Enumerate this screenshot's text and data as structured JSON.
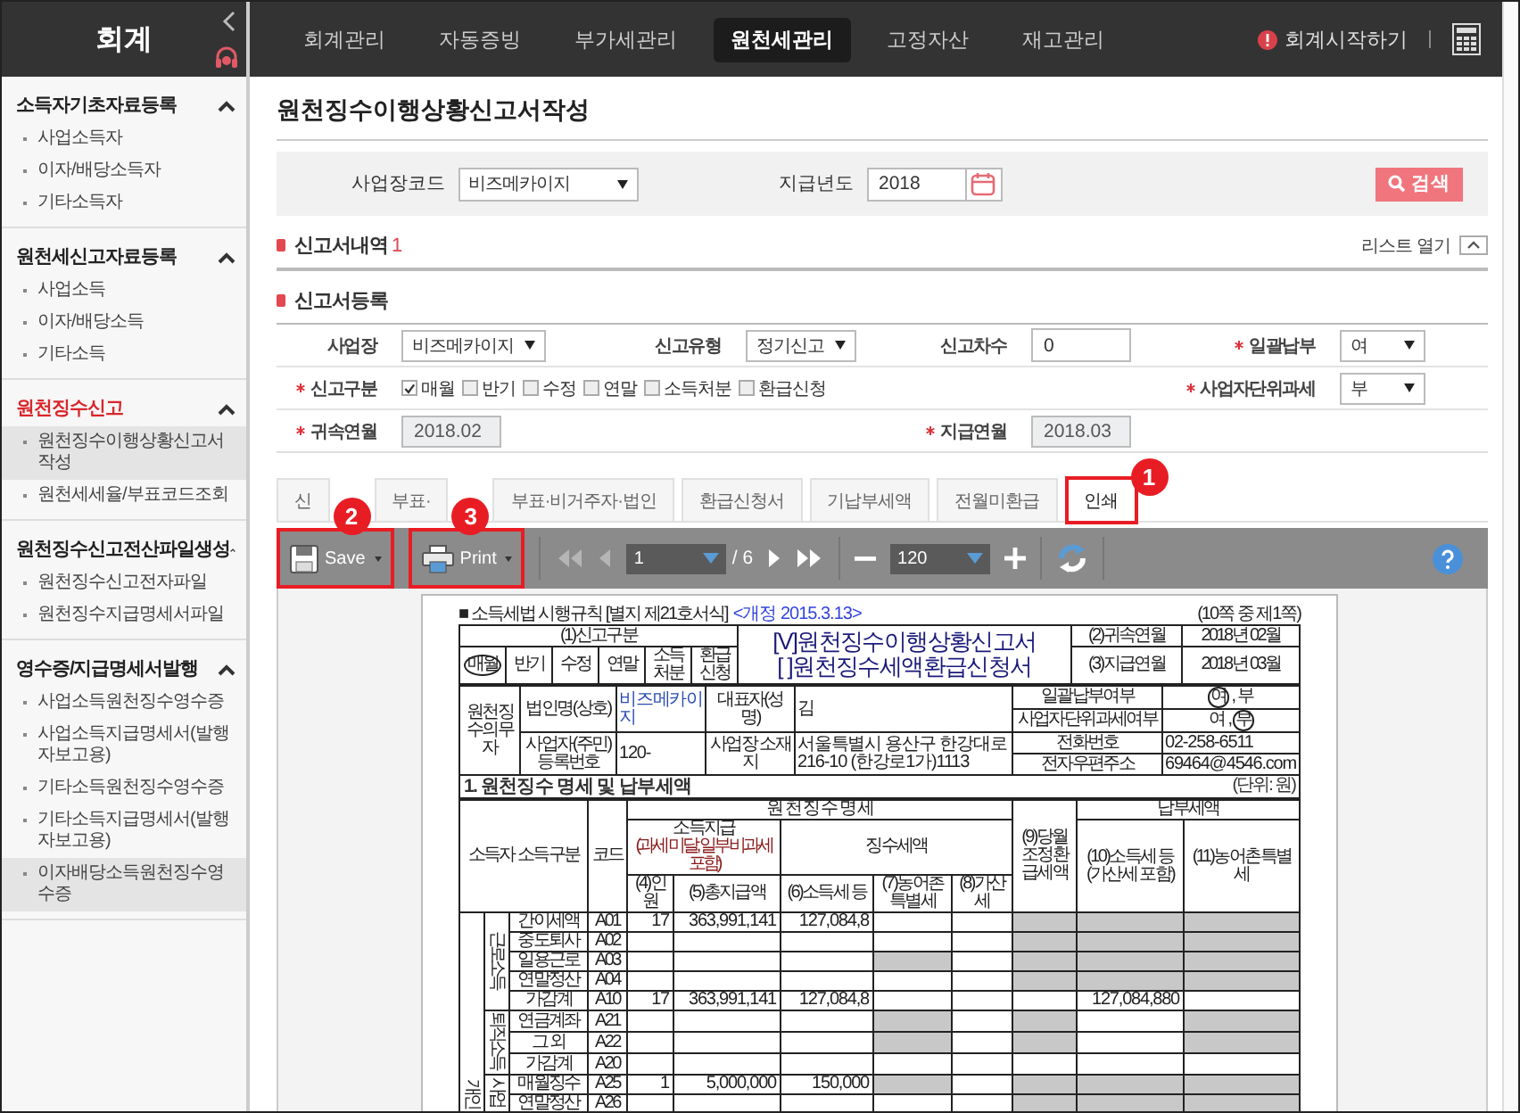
{
  "app_title": "회계",
  "sidebar": [
    {
      "title": "소득자기초자료등록",
      "active": false,
      "items": [
        {
          "label": "사업소득자",
          "selected": false
        },
        {
          "label": "이자/배당소득자",
          "selected": false
        },
        {
          "label": "기타소득자",
          "selected": false
        }
      ]
    },
    {
      "title": "원천세신고자료등록",
      "active": false,
      "items": [
        {
          "label": "사업소득",
          "selected": false
        },
        {
          "label": "이자/배당소득",
          "selected": false
        },
        {
          "label": "기타소득",
          "selected": false
        }
      ]
    },
    {
      "title": "원천징수신고",
      "active": true,
      "items": [
        {
          "label": "원천징수이행상황신고서작성",
          "selected": true
        },
        {
          "label": "원천세세율/부표코드조회",
          "selected": false
        }
      ]
    },
    {
      "title": "원천징수신고전산파일생성",
      "active": false,
      "items": [
        {
          "label": "원천징수신고전자파일",
          "selected": false
        },
        {
          "label": "원천징수지급명세서파일",
          "selected": false
        }
      ]
    },
    {
      "title": "영수증/지급명세서발행",
      "active": false,
      "items": [
        {
          "label": "사업소득원천징수영수증",
          "selected": false
        },
        {
          "label": "사업소득지급명세서(발행자보고용)",
          "selected": false
        },
        {
          "label": "기타소득원천징수영수증",
          "selected": false
        },
        {
          "label": "기타소득지급명세서(발행자보고용)",
          "selected": false
        },
        {
          "label": "이자배당소득원천징수영수증",
          "selected": true
        }
      ]
    }
  ],
  "top_nav": [
    {
      "label": "회계관리",
      "selected": false
    },
    {
      "label": "자동증빙",
      "selected": false
    },
    {
      "label": "부가세관리",
      "selected": false
    },
    {
      "label": "원천세관리",
      "selected": true
    },
    {
      "label": "고정자산",
      "selected": false
    },
    {
      "label": "재고관리",
      "selected": false
    }
  ],
  "start_link": "회계시작하기",
  "page_title": "원천징수이행상황신고서작성",
  "search": {
    "fields": [
      {
        "label": "사업장코드",
        "kind": "select",
        "value": "비즈메카이지"
      },
      {
        "label": "지급년도",
        "kind": "date",
        "value": "2018"
      }
    ],
    "button": "검색"
  },
  "report_list": {
    "title": "신고서내역",
    "count": "1",
    "toggle": "리스트 열기"
  },
  "registration": {
    "title": "신고서등록",
    "rows": [
      [
        {
          "label": "사업장",
          "required": false,
          "kind": "select",
          "value": "비즈메카이지"
        },
        {
          "label": "신고유형",
          "required": false,
          "kind": "select",
          "value": "정기신고"
        },
        {
          "label": "신고차수",
          "required": false,
          "kind": "input",
          "value": "0"
        },
        {
          "label": "일괄납부",
          "required": true,
          "kind": "select",
          "value": "여"
        }
      ],
      [
        {
          "label": "신고구분",
          "required": true,
          "kind": "checks",
          "options": [
            {
              "label": "매월",
              "checked": true
            },
            {
              "label": "반기",
              "checked": false
            },
            {
              "label": "수정",
              "checked": false
            },
            {
              "label": "연말",
              "checked": false
            },
            {
              "label": "소득처분",
              "checked": false
            },
            {
              "label": "환급신청",
              "checked": false
            }
          ]
        },
        {
          "kind": "blank"
        },
        {
          "kind": "blank"
        },
        {
          "label": "사업자단위과세",
          "required": true,
          "kind": "select",
          "value": "부"
        }
      ],
      [
        {
          "label": "귀속연월",
          "required": true,
          "kind": "readonly",
          "value": "2018.02"
        },
        {
          "kind": "blank"
        },
        {
          "label": "지급연월",
          "required": true,
          "kind": "readonly",
          "value": "2018.03"
        },
        {
          "kind": "blank"
        }
      ]
    ]
  },
  "tabs": [
    {
      "label": "신",
      "selected": false
    },
    {
      "label": "부표·",
      "selected": false
    },
    {
      "label": "부표·비거주자·법인",
      "selected": false
    },
    {
      "label": "환급신청서",
      "selected": false
    },
    {
      "label": "기납부세액",
      "selected": false
    },
    {
      "label": "전월미환급",
      "selected": false
    },
    {
      "label": "인쇄",
      "selected": true,
      "callout": "1"
    }
  ],
  "viewer": {
    "save": {
      "label": "Save",
      "callout": "2"
    },
    "print": {
      "label": "Print",
      "callout": "3"
    },
    "page": "1",
    "page_total": "/ 6",
    "zoom": "120"
  },
  "document": {
    "form_ref": "■ 소득세법 시행규칙 [별지 제21호서식]",
    "revision": "<개정 2015.3.13>",
    "page_info": "(10쪽 중 제1쪽)",
    "type_header": "(1)신고구분",
    "types": [
      {
        "label": "매월",
        "selected": true
      },
      {
        "label": "반기",
        "selected": false
      },
      {
        "label": "수정",
        "selected": false
      },
      {
        "label": "연말",
        "selected": false
      },
      {
        "label": "소득처분",
        "selected": false
      },
      {
        "label": "환급신청",
        "selected": false
      }
    ],
    "titles": [
      "[V]원천징수이행상황신고서",
      "[  ]원천징수세액환급신청서"
    ],
    "periods": [
      {
        "label": "(2)귀속연월",
        "value": "2018년 02월"
      },
      {
        "label": "(3)지급연월",
        "value": "2018년 03월"
      }
    ],
    "withholder": {
      "label": "원천징수의무자",
      "name_label": "법인명(상호)",
      "name": "비즈메카이지",
      "ceo_label": "대표자(성명)",
      "ceo": "김",
      "reg_label": "사업자(주민)등록번호",
      "reg": "120-",
      "addr_label": "사업장 소재지",
      "addr": "서울특별시 용산구 한강대로 216-10 (한강로1가)1113",
      "choices": [
        {
          "label": "일괄납부여부",
          "separator": ",",
          "options": [
            {
              "label": "여",
              "selected": true
            },
            {
              "label": "부",
              "selected": false
            }
          ]
        },
        {
          "label": "사업자단위과세여부",
          "separator": ",",
          "options": [
            {
              "label": "여",
              "selected": false
            },
            {
              "label": "부",
              "selected": true
            }
          ]
        }
      ],
      "contacts": [
        {
          "label": "전화번호",
          "value": "02-258-6511"
        },
        {
          "label": "전자우편주소",
          "value": "69464@4546.com"
        }
      ]
    },
    "section": "1. 원천징수 명세 및 납부세액",
    "unit": "(단위: 원)",
    "head": {
      "category": "소득자 소득구분",
      "code": "코드",
      "detail": "원 천 징 수 명 세",
      "payment": "소득지급",
      "payment_note": "(과세 미달, 일부 비과세 포함)",
      "collected": "징수세액",
      "refund": "(9)당월조정환급세액",
      "tax_due": "납부세액",
      "cols": [
        "(4)인원",
        "(5)총지급액",
        "(6)소득세 등",
        "(7)농어촌특별세",
        "(8)가산세"
      ],
      "due_cols": [
        "(10)소득세 등(가산세 포함)",
        "(11)농어촌특별세"
      ]
    },
    "category": "개인",
    "groups": [
      {
        "label": "근로소득",
        "rows": [
          {
            "name": "간이세액",
            "code": "A01",
            "cells": [
              {
                "text": "17",
                "shaded": false
              },
              {
                "text": "363,991,141",
                "shaded": false
              },
              {
                "text": "127,084,8",
                "shaded": false
              },
              {
                "shaded": false
              },
              {
                "shaded": false
              },
              {
                "shaded": true
              },
              {
                "shaded": true
              },
              {
                "shaded": true
              }
            ]
          },
          {
            "name": "중도퇴사",
            "code": "A02",
            "cells": [
              {
                "shaded": false
              },
              {
                "shaded": false
              },
              {
                "shaded": false
              },
              {
                "shaded": false
              },
              {
                "shaded": false
              },
              {
                "shaded": true
              },
              {
                "shaded": true
              },
              {
                "shaded": true
              }
            ]
          },
          {
            "name": "일용근로",
            "code": "A03",
            "cells": [
              {
                "shaded": false
              },
              {
                "shaded": false
              },
              {
                "shaded": false
              },
              {
                "shaded": true
              },
              {
                "shaded": false
              },
              {
                "shaded": true
              },
              {
                "shaded": true
              },
              {
                "shaded": true
              }
            ]
          },
          {
            "name": "연말정산",
            "code": "A04",
            "cells": [
              {
                "shaded": false
              },
              {
                "shaded": false
              },
              {
                "shaded": false
              },
              {
                "shaded": false
              },
              {
                "shaded": false
              },
              {
                "shaded": true
              },
              {
                "shaded": true
              },
              {
                "shaded": true
              }
            ]
          },
          {
            "name": "가감계",
            "code": "A10",
            "cells": [
              {
                "text": "17",
                "shaded": false
              },
              {
                "text": "363,991,141",
                "shaded": false
              },
              {
                "text": "127,084,8",
                "shaded": false
              },
              {
                "shaded": false
              },
              {
                "shaded": false
              },
              {
                "shaded": false
              },
              {
                "text": "127,084,880",
                "shaded": false
              },
              {
                "shaded": false
              }
            ]
          }
        ]
      },
      {
        "label": "퇴직소득",
        "rows": [
          {
            "name": "연금계좌",
            "code": "A21",
            "cells": [
              {
                "shaded": false
              },
              {
                "shaded": false
              },
              {
                "shaded": false
              },
              {
                "shaded": true
              },
              {
                "shaded": false
              },
              {
                "shaded": true
              },
              {
                "shaded": false
              },
              {
                "shaded": true
              }
            ]
          },
          {
            "name": "그 외",
            "code": "A22",
            "cells": [
              {
                "shaded": false
              },
              {
                "shaded": false
              },
              {
                "shaded": false
              },
              {
                "shaded": true
              },
              {
                "shaded": false
              },
              {
                "shaded": true
              },
              {
                "shaded": false
              },
              {
                "shaded": true
              }
            ]
          },
          {
            "name": "가감계",
            "code": "A20",
            "cells": [
              {
                "shaded": false
              },
              {
                "shaded": false
              },
              {
                "shaded": false
              },
              {
                "shaded": false
              },
              {
                "shaded": false
              },
              {
                "shaded": false
              },
              {
                "shaded": false
              },
              {
                "shaded": false
              }
            ]
          }
        ]
      },
      {
        "label": "사업",
        "rows": [
          {
            "name": "매월징수",
            "code": "A25",
            "cells": [
              {
                "text": "1",
                "shaded": false
              },
              {
                "text": "5,000,000",
                "shaded": false
              },
              {
                "text": "150,000",
                "shaded": false
              },
              {
                "shaded": true
              },
              {
                "shaded": false
              },
              {
                "shaded": true
              },
              {
                "shaded": true
              },
              {
                "shaded": true
              }
            ]
          },
          {
            "name": "연말정산",
            "code": "A26",
            "cells": [
              {
                "shaded": false
              },
              {
                "shaded": false
              },
              {
                "shaded": false
              },
              {
                "shaded": false
              },
              {
                "shaded": false
              },
              {
                "shaded": true
              },
              {
                "shaded": true
              },
              {
                "shaded": true
              }
            ]
          }
        ]
      }
    ]
  }
}
